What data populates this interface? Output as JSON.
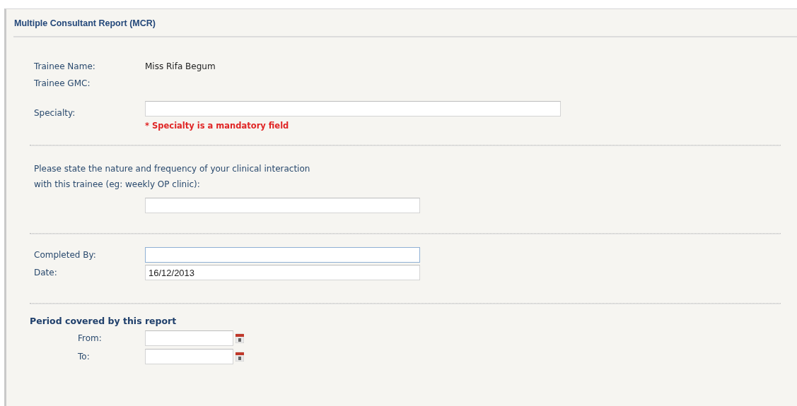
{
  "panel": {
    "title": "Multiple Consultant Report (MCR)"
  },
  "trainee": {
    "name_label": "Trainee Name:",
    "name_value": "Miss Rifa Begum",
    "gmc_label": "Trainee GMC:",
    "specialty_label": "Specialty:",
    "specialty_error": "* Specialty is a mandatory field"
  },
  "interaction": {
    "question_lines": [
      "Please state the nature and frequency of your clinical interaction",
      "with this trainee (eg: weekly OP clinic):"
    ]
  },
  "completion": {
    "fields": [
      {
        "label": "Completed By:",
        "focused": true
      },
      {
        "label": "Date:",
        "value": "16/12/2013",
        "focused": false
      }
    ]
  },
  "period": {
    "heading": "Period covered by this report",
    "fields": [
      {
        "label": "From:"
      },
      {
        "label": "To:"
      }
    ]
  }
}
